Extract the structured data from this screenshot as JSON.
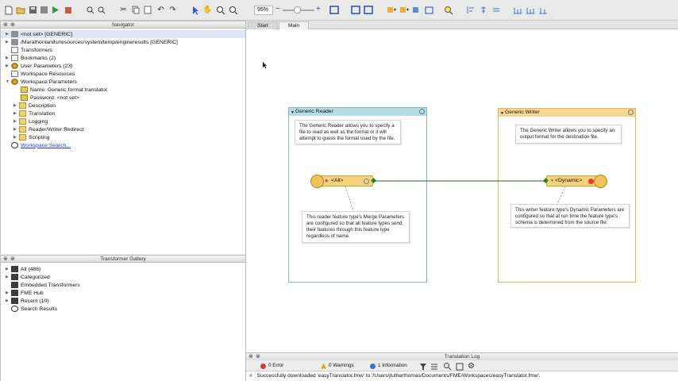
{
  "toolbar": {
    "zoom_value": "95%",
    "zoom_minus": "−",
    "zoom_plus": "+"
  },
  "navigator": {
    "title": "Navigator",
    "items": [
      {
        "label": "<not set> [GENERIC]",
        "icon": "workspace-icon"
      },
      {
        "label": "/Marathonlands/resources/system/temp/engineresults [GENERIC]",
        "icon": "workspace-icon"
      },
      {
        "label": "Transformers",
        "icon": "transformer-icon"
      },
      {
        "label": "Bookmarks (2)",
        "icon": "bookmark-icon"
      },
      {
        "label": "User Parameters (23)",
        "icon": "user-parameters-icon"
      },
      {
        "label": "Workspace Resources",
        "icon": "resources-icon"
      },
      {
        "label": "Workspace Parameters",
        "icon": "parameters-icon"
      },
      {
        "label": "Name: Generic format translator",
        "icon": "parameter-icon"
      },
      {
        "label": "Password: <not set>",
        "icon": "parameter-icon"
      },
      {
        "label": "Description",
        "icon": "folder-icon"
      },
      {
        "label": "Translation",
        "icon": "folder-icon"
      },
      {
        "label": "Logging",
        "icon": "folder-icon"
      },
      {
        "label": "Reader/Writer Redirect",
        "icon": "folder-icon"
      },
      {
        "label": "Scripting",
        "icon": "folder-icon"
      },
      {
        "label": "Workspace Search...",
        "icon": "search-icon"
      }
    ]
  },
  "gallery": {
    "title": "Transformer Gallery",
    "items": [
      {
        "label": "All (486)"
      },
      {
        "label": "Categorized"
      },
      {
        "label": "Embedded Transformers"
      },
      {
        "label": "FME Hub"
      },
      {
        "label": "Recent (10)"
      },
      {
        "label": "Search Results"
      }
    ]
  },
  "tabs": [
    {
      "label": "Start",
      "active": false
    },
    {
      "label": "Main",
      "active": true
    }
  ],
  "canvas": {
    "reader_bookmark": {
      "title": "Generic Reader",
      "note": "The Generic Reader allows you to specify a file to read as well as the format or it will attempt to guess the format used by the file.",
      "feature_label": "<All>",
      "feature_note": "This reader feature type's Merge Parameters are configured so that all feature types send their features through this feature type regardless of name."
    },
    "writer_bookmark": {
      "title": "Generic Writer",
      "note": "The Generic Writer allows you to specify an output format for the destination file.",
      "feature_label": "<Dynamic>",
      "feature_note": "This writer feature type's Dynamic Parameters are configured so that at run time the feature type's schema is determined from the source file."
    }
  },
  "log": {
    "title": "Translation Log",
    "filters": [
      {
        "label": "0 Error",
        "color": "#d93a2f"
      },
      {
        "label": "0 Warnings",
        "color": "#e3a21a"
      },
      {
        "label": "1 Information",
        "color": "#3a6fd1"
      }
    ],
    "line_number": "4",
    "message": "Successfully downloaded 'easyTranslator.fmw' to '/Users/jlutherthomas/Documents/FME/Workspaces/easyTranslator.fmw'."
  },
  "colors": {
    "reader_border": "#7fb9cf",
    "reader_head": "#b7dbe8",
    "writer_border": "#e9b552",
    "writer_head": "#f6d893",
    "feature_fill": "#f7d27a",
    "connection": "#1a6b1a"
  }
}
